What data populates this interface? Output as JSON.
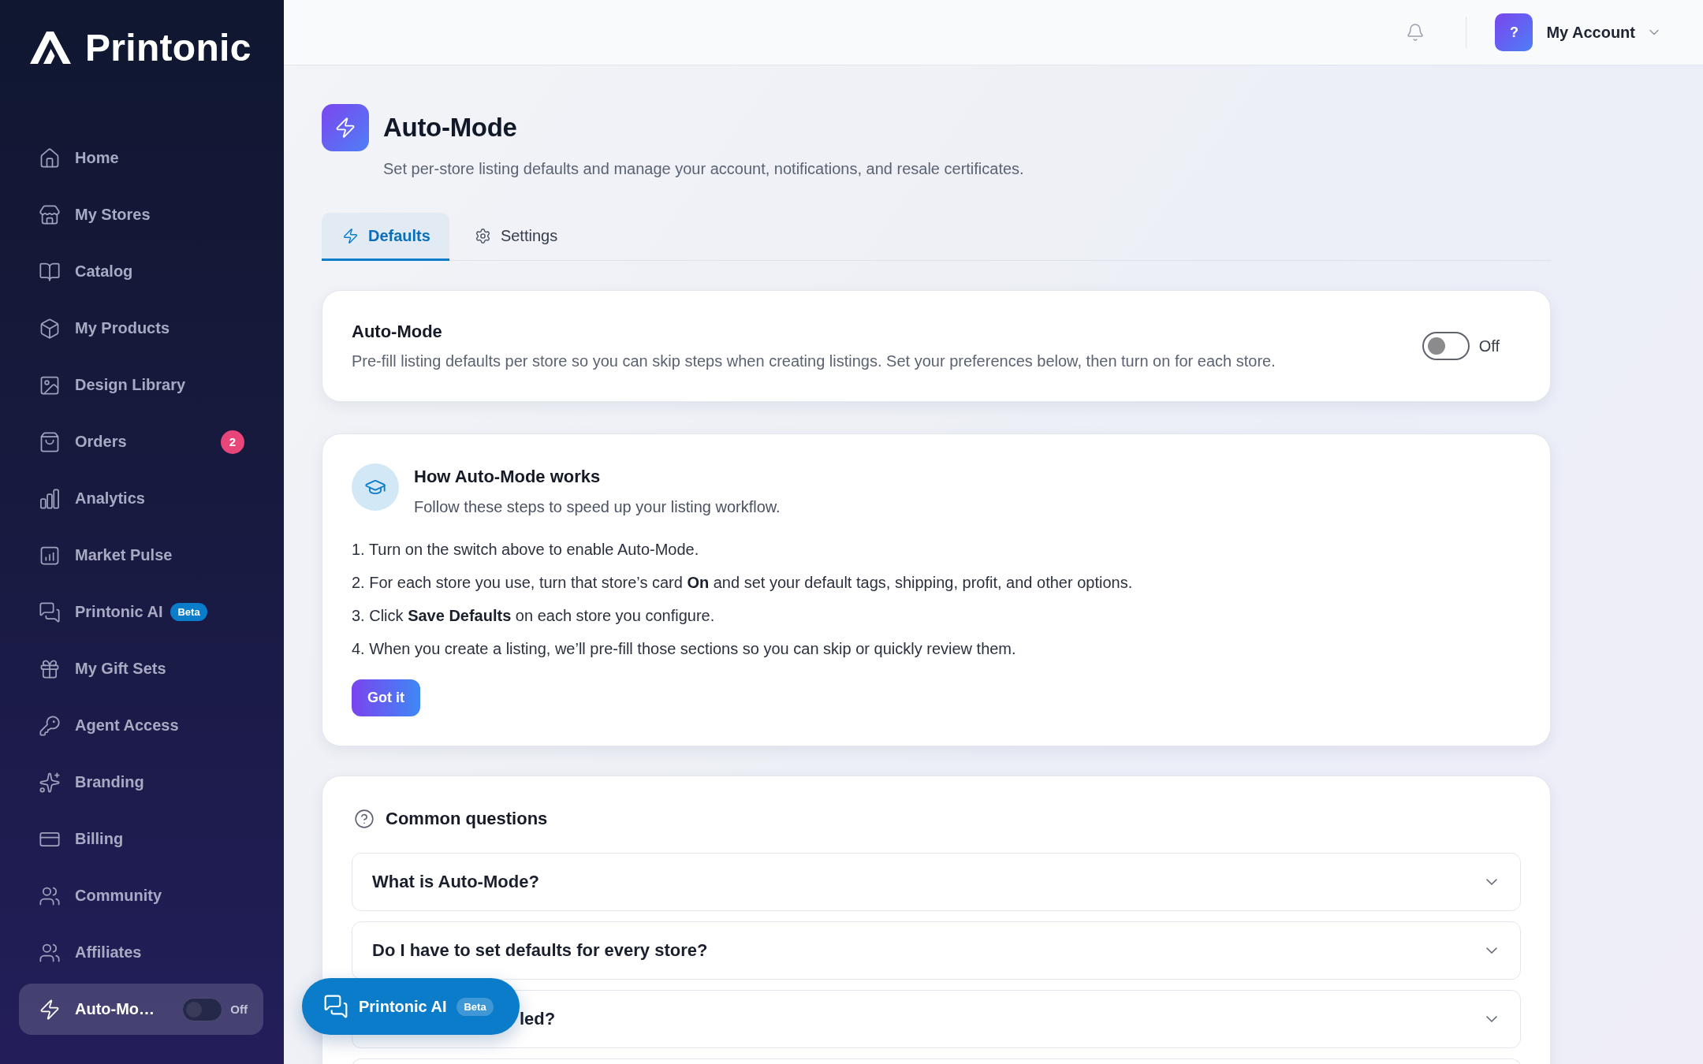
{
  "sidebar": {
    "logo": "Printonic",
    "items": [
      {
        "label": "Home",
        "selected": false
      },
      {
        "label": "My Stores",
        "selected": false
      },
      {
        "label": "Catalog",
        "selected": false
      },
      {
        "label": "My Products",
        "selected": false
      },
      {
        "label": "Design Library",
        "selected": false
      },
      {
        "label": "Orders",
        "selected": false,
        "badge": "2"
      },
      {
        "label": "Analytics",
        "selected": false
      },
      {
        "label": "Market Pulse",
        "selected": false
      },
      {
        "label": "Printonic AI",
        "selected": false,
        "tag": "Beta"
      },
      {
        "label": "My Gift Sets",
        "selected": false
      },
      {
        "label": "Agent Access",
        "selected": false
      },
      {
        "label": "Branding",
        "selected": false
      },
      {
        "label": "Billing",
        "selected": false
      },
      {
        "label": "Community",
        "selected": false
      },
      {
        "label": "Affiliates",
        "selected": false
      },
      {
        "label": "Auto-Mo…",
        "selected": true,
        "toggle": {
          "on": false,
          "label": "Off"
        }
      }
    ]
  },
  "top_bar": {
    "avatar": "?",
    "account": "My Account"
  },
  "page": {
    "title": "Auto-Mode",
    "subtitle": "Set per-store listing defaults and manage your account, notifications, and resale certificates.",
    "tabs": [
      {
        "label": "Defaults",
        "selected": true
      },
      {
        "label": "Settings",
        "selected": false
      }
    ]
  },
  "auto_mode_card": {
    "title": "Auto-Mode",
    "description": "Pre-fill listing defaults per store so you can skip steps when creating listings. Set your preferences below, then turn on for each store.",
    "toggle": {
      "on": false,
      "label": "Off"
    }
  },
  "how_it_works": {
    "title": "How Auto-Mode works",
    "subtitle": "Follow these steps to speed up your listing workflow.",
    "steps": [
      "1. Turn on the switch above to enable Auto-Mode.",
      "2. For each store you use, turn that store’s card **On** and set your default tags, shipping, profit, and other options.",
      "3. Click **Save Defaults** on each store you configure.",
      "4. When you create a listing, we’ll pre-fill those sections so you can skip or quickly review them."
    ],
    "button": "Got it"
  },
  "faq": {
    "title": "Common questions",
    "questions": [
      {
        "kind": "question",
        "text": "What is Auto-Mode?",
        "expanded": false
      },
      {
        "kind": "question",
        "text": "Do I have to set defaults for every store?",
        "expanded": false
      },
      {
        "kind": "covered",
        "text": "led?",
        "expanded": false
      }
    ]
  },
  "chat_button": {
    "label": "Printonic AI",
    "tag": "Beta"
  }
}
